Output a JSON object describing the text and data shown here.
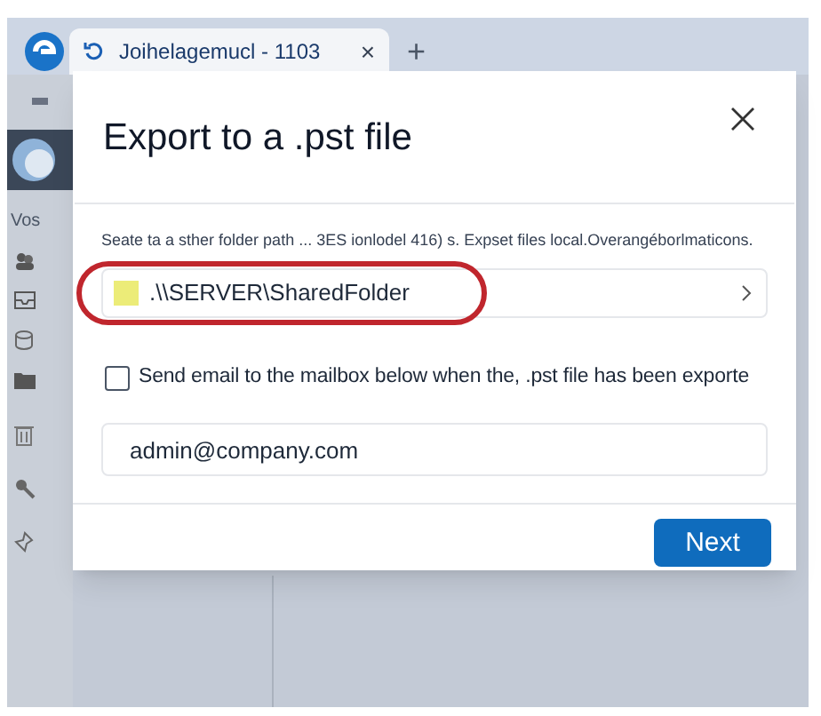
{
  "browser": {
    "tab": {
      "title": "Joihelagemucl - 1103",
      "selected": true
    },
    "new_tab": "+",
    "close_tab": "×"
  },
  "sidebar": {
    "label": "Vos"
  },
  "dialog": {
    "title": "Export to a .pst file",
    "description": "Seate ta a sther folder path ... 3ES ionlodel 416) s. Expset files local.Overangéborlmaticons.",
    "path_field": {
      "value": ".\\\\SERVER\\SharedFolder",
      "highlighted": true
    },
    "send_email": {
      "label": "Send email to the mailbox below when the, .pst file has been exporte",
      "checked": false
    },
    "email_field": {
      "value": "admin@company.com"
    },
    "buttons": [
      {
        "label": "Next",
        "kind": "primary"
      }
    ]
  }
}
